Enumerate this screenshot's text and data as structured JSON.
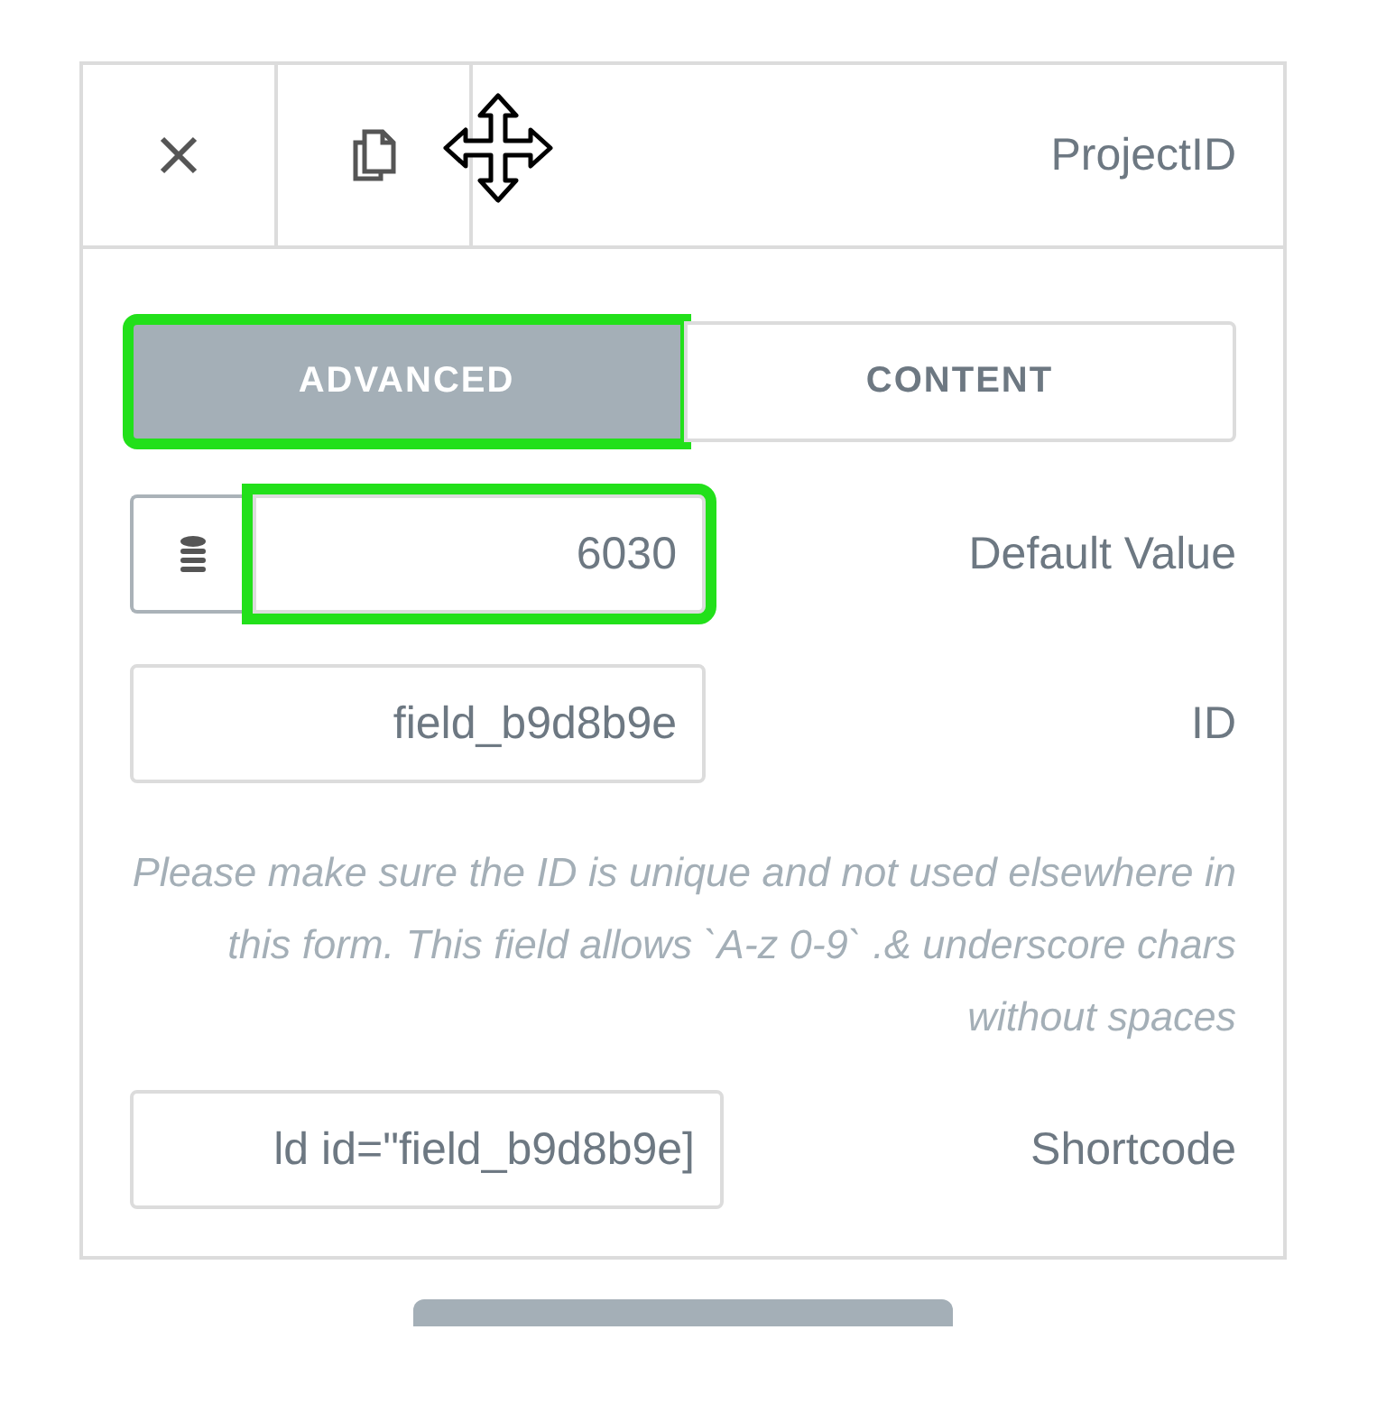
{
  "header": {
    "title": "ProjectID"
  },
  "tabs": [
    {
      "label": "ADVANCED",
      "selected": true,
      "highlighted": true
    },
    {
      "label": "CONTENT",
      "selected": false,
      "highlighted": false
    }
  ],
  "fields": [
    {
      "kind": "dynamic",
      "label": "Default Value",
      "value": "6030",
      "highlighted": true
    },
    {
      "kind": "text",
      "label": "ID",
      "value": "field_b9d8b9e",
      "highlighted": false
    },
    {
      "kind": "help",
      "text": "Please make sure the ID is unique and not used elsewhere in this form. This field allows `A-z 0-9` .& underscore chars without spaces"
    },
    {
      "kind": "text",
      "label": "Shortcode",
      "value": "ld id=\"field_b9d8b9e]",
      "highlighted": false
    }
  ]
}
